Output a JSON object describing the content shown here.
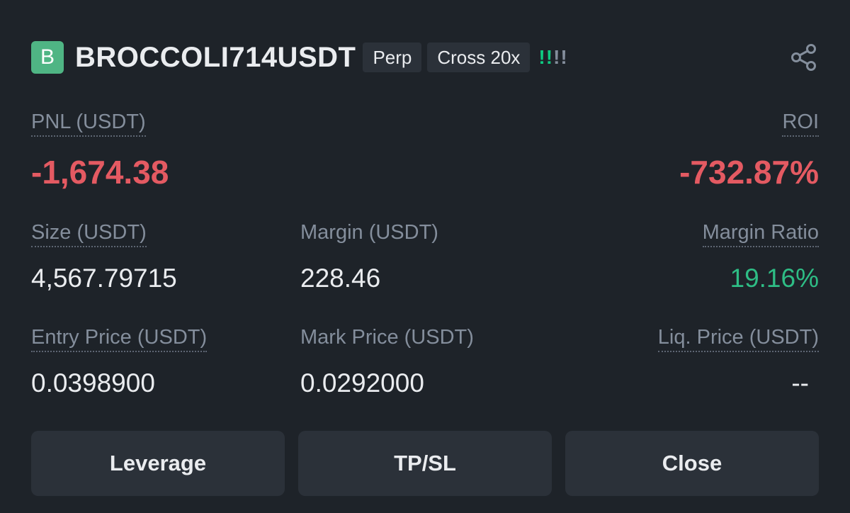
{
  "header": {
    "coin_badge": "B",
    "symbol": "BROCCOLI714USDT",
    "tag_type": "Perp",
    "tag_margin": "Cross 20x",
    "signal_strong": "!!",
    "signal_weak": "!!"
  },
  "pnl": {
    "label": "PNL (USDT)",
    "value": "-1,674.38"
  },
  "roi": {
    "label": "ROI",
    "value": "-732.87%"
  },
  "size": {
    "label": "Size (USDT)",
    "value": "4,567.79715"
  },
  "margin": {
    "label": "Margin (USDT)",
    "value": "228.46"
  },
  "margin_ratio": {
    "label": "Margin Ratio",
    "value": "19.16%"
  },
  "entry_price": {
    "label": "Entry Price (USDT)",
    "value": "0.0398900"
  },
  "mark_price": {
    "label": "Mark Price (USDT)",
    "value": "0.0292000"
  },
  "liq_price": {
    "label": "Liq. Price (USDT)",
    "value": "--"
  },
  "buttons": {
    "leverage": "Leverage",
    "tpsl": "TP/SL",
    "close": "Close"
  },
  "colors": {
    "background": "#1e2329",
    "loss_red": "#e45a62",
    "profit_green": "#2ebd85",
    "badge_green": "#4fb584"
  },
  "icons": {
    "share": "share-icon"
  }
}
